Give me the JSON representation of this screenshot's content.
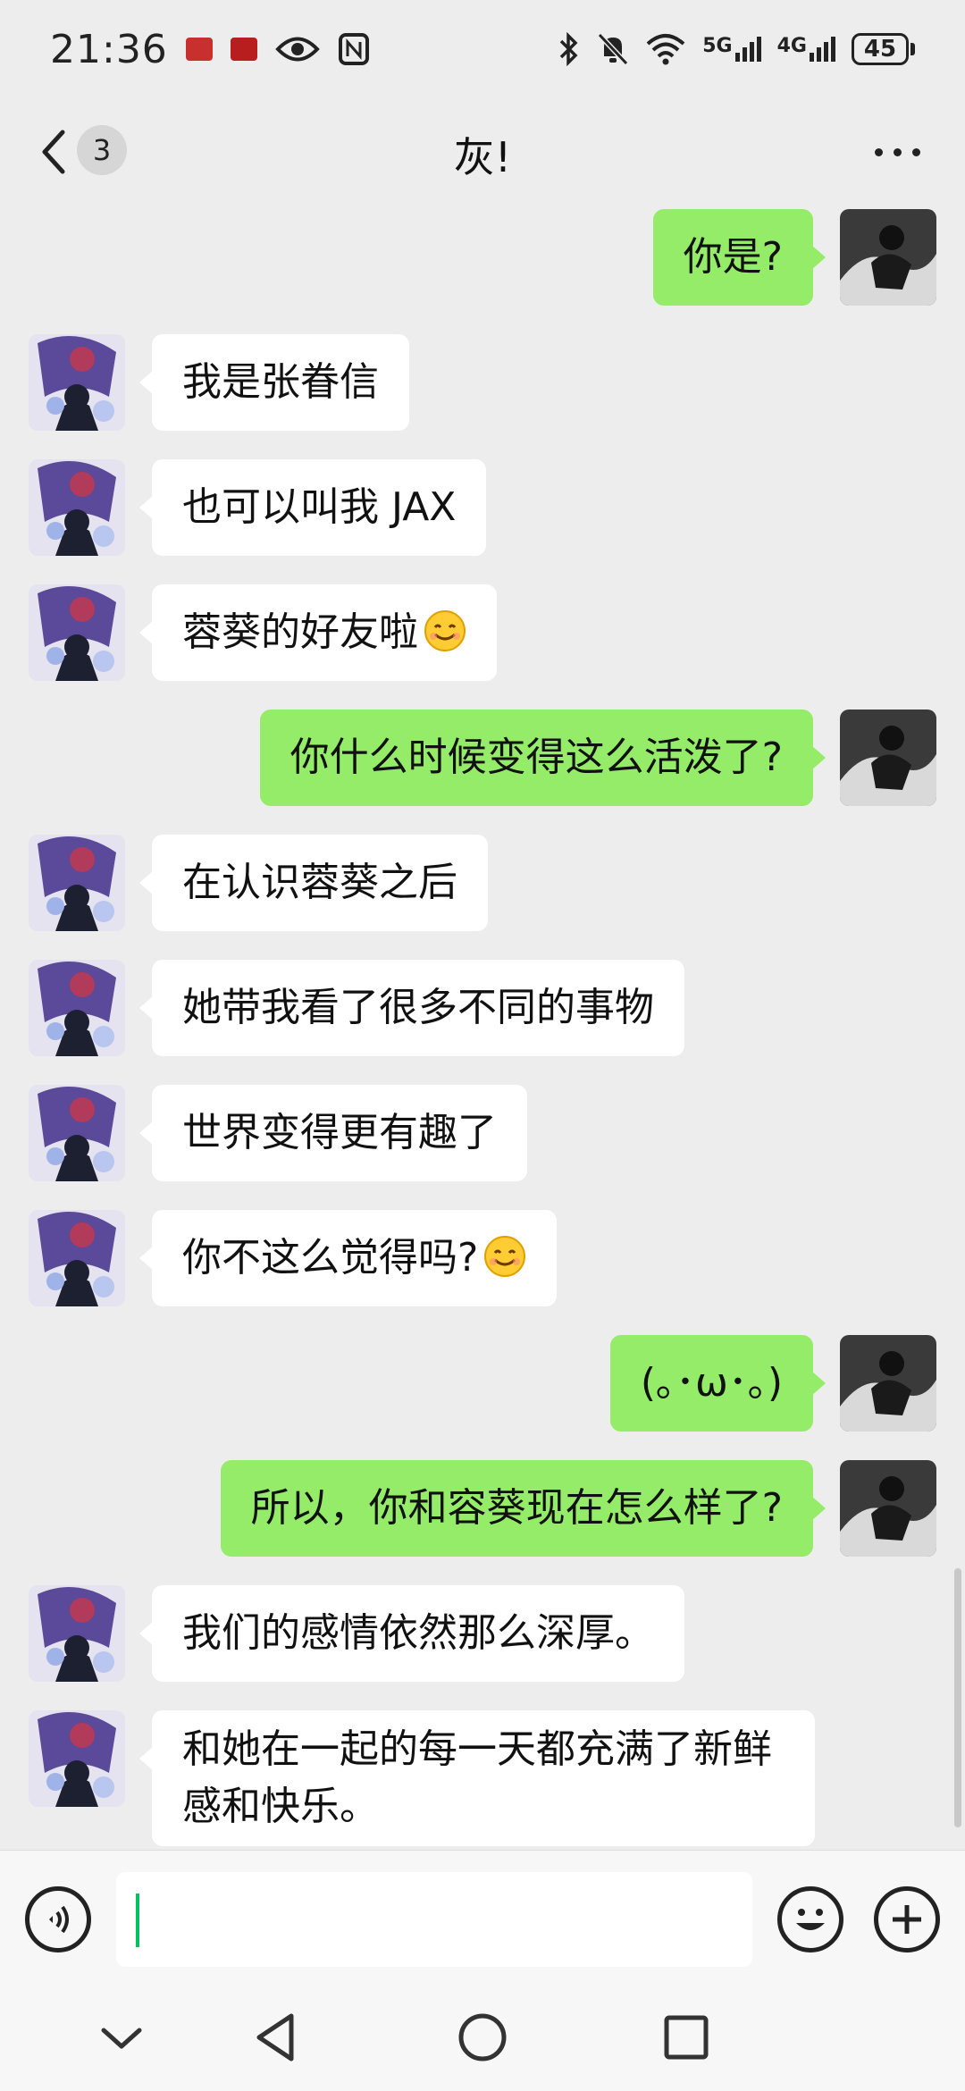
{
  "status_bar": {
    "time": "21:36",
    "net_5g": "5G",
    "net_4g": "4G",
    "battery": "45",
    "icons": [
      "app-notif-icon",
      "app-notif-icon-2",
      "eye-icon",
      "nfc-icon",
      "bluetooth-icon",
      "mute-bell-icon",
      "wifi-icon",
      "signal-5g-icon",
      "signal-4g-icon",
      "battery-icon"
    ]
  },
  "nav": {
    "unread_count": "3",
    "title": "灰!"
  },
  "messages": [
    {
      "from": "self",
      "text": "你是?"
    },
    {
      "from": "other",
      "text": "我是张眷信"
    },
    {
      "from": "other",
      "text": "也可以叫我 JAX"
    },
    {
      "from": "other",
      "text": "蓉葵的好友啦",
      "emoji": "smile"
    },
    {
      "from": "self",
      "text": "你什么时候变得这么活泼了?"
    },
    {
      "from": "other",
      "text": "在认识蓉葵之后"
    },
    {
      "from": "other",
      "text": "她带我看了很多不同的事物"
    },
    {
      "from": "other",
      "text": "世界变得更有趣了"
    },
    {
      "from": "other",
      "text": "你不这么觉得吗?",
      "emoji": "smile"
    },
    {
      "from": "self",
      "text": "(｡･ω･｡)"
    },
    {
      "from": "self",
      "text": "所以，你和容葵现在怎么样了?"
    },
    {
      "from": "other",
      "text": "我们的感情依然那么深厚。"
    },
    {
      "from": "other",
      "text": "和她在一起的每一天都充满了新鲜感和快乐。"
    }
  ],
  "input": {
    "value": "",
    "placeholder": ""
  },
  "colors": {
    "background": "#ededed",
    "self_bubble": "#95ec69",
    "other_bubble": "#ffffff",
    "caret": "#07c160"
  }
}
